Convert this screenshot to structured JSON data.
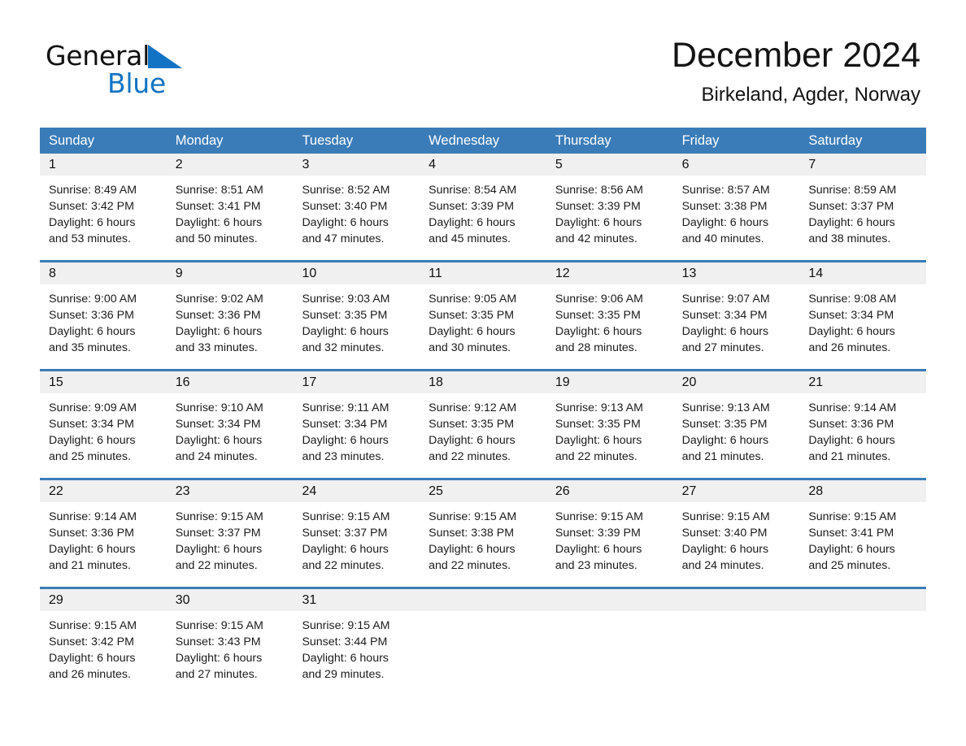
{
  "brand": {
    "name_part1": "General",
    "name_part2": "Blue",
    "triangle_color": "#1273c4",
    "text_color": "#101010"
  },
  "header": {
    "month_title": "December 2024",
    "location": "Birkeland, Agder, Norway"
  },
  "theme": {
    "header_blue": "#3a7cb8",
    "daynum_band": "#f0f0f0",
    "page_background": "#ffffff"
  },
  "weekdays": [
    "Sunday",
    "Monday",
    "Tuesday",
    "Wednesday",
    "Thursday",
    "Friday",
    "Saturday"
  ],
  "weeks": [
    {
      "days": [
        {
          "num": "1",
          "sunrise": "Sunrise: 8:49 AM",
          "sunset": "Sunset: 3:42 PM",
          "daylight_line1": "Daylight: 6 hours",
          "daylight_line2": "and 53 minutes."
        },
        {
          "num": "2",
          "sunrise": "Sunrise: 8:51 AM",
          "sunset": "Sunset: 3:41 PM",
          "daylight_line1": "Daylight: 6 hours",
          "daylight_line2": "and 50 minutes."
        },
        {
          "num": "3",
          "sunrise": "Sunrise: 8:52 AM",
          "sunset": "Sunset: 3:40 PM",
          "daylight_line1": "Daylight: 6 hours",
          "daylight_line2": "and 47 minutes."
        },
        {
          "num": "4",
          "sunrise": "Sunrise: 8:54 AM",
          "sunset": "Sunset: 3:39 PM",
          "daylight_line1": "Daylight: 6 hours",
          "daylight_line2": "and 45 minutes."
        },
        {
          "num": "5",
          "sunrise": "Sunrise: 8:56 AM",
          "sunset": "Sunset: 3:39 PM",
          "daylight_line1": "Daylight: 6 hours",
          "daylight_line2": "and 42 minutes."
        },
        {
          "num": "6",
          "sunrise": "Sunrise: 8:57 AM",
          "sunset": "Sunset: 3:38 PM",
          "daylight_line1": "Daylight: 6 hours",
          "daylight_line2": "and 40 minutes."
        },
        {
          "num": "7",
          "sunrise": "Sunrise: 8:59 AM",
          "sunset": "Sunset: 3:37 PM",
          "daylight_line1": "Daylight: 6 hours",
          "daylight_line2": "and 38 minutes."
        }
      ]
    },
    {
      "days": [
        {
          "num": "8",
          "sunrise": "Sunrise: 9:00 AM",
          "sunset": "Sunset: 3:36 PM",
          "daylight_line1": "Daylight: 6 hours",
          "daylight_line2": "and 35 minutes."
        },
        {
          "num": "9",
          "sunrise": "Sunrise: 9:02 AM",
          "sunset": "Sunset: 3:36 PM",
          "daylight_line1": "Daylight: 6 hours",
          "daylight_line2": "and 33 minutes."
        },
        {
          "num": "10",
          "sunrise": "Sunrise: 9:03 AM",
          "sunset": "Sunset: 3:35 PM",
          "daylight_line1": "Daylight: 6 hours",
          "daylight_line2": "and 32 minutes."
        },
        {
          "num": "11",
          "sunrise": "Sunrise: 9:05 AM",
          "sunset": "Sunset: 3:35 PM",
          "daylight_line1": "Daylight: 6 hours",
          "daylight_line2": "and 30 minutes."
        },
        {
          "num": "12",
          "sunrise": "Sunrise: 9:06 AM",
          "sunset": "Sunset: 3:35 PM",
          "daylight_line1": "Daylight: 6 hours",
          "daylight_line2": "and 28 minutes."
        },
        {
          "num": "13",
          "sunrise": "Sunrise: 9:07 AM",
          "sunset": "Sunset: 3:34 PM",
          "daylight_line1": "Daylight: 6 hours",
          "daylight_line2": "and 27 minutes."
        },
        {
          "num": "14",
          "sunrise": "Sunrise: 9:08 AM",
          "sunset": "Sunset: 3:34 PM",
          "daylight_line1": "Daylight: 6 hours",
          "daylight_line2": "and 26 minutes."
        }
      ]
    },
    {
      "days": [
        {
          "num": "15",
          "sunrise": "Sunrise: 9:09 AM",
          "sunset": "Sunset: 3:34 PM",
          "daylight_line1": "Daylight: 6 hours",
          "daylight_line2": "and 25 minutes."
        },
        {
          "num": "16",
          "sunrise": "Sunrise: 9:10 AM",
          "sunset": "Sunset: 3:34 PM",
          "daylight_line1": "Daylight: 6 hours",
          "daylight_line2": "and 24 minutes."
        },
        {
          "num": "17",
          "sunrise": "Sunrise: 9:11 AM",
          "sunset": "Sunset: 3:34 PM",
          "daylight_line1": "Daylight: 6 hours",
          "daylight_line2": "and 23 minutes."
        },
        {
          "num": "18",
          "sunrise": "Sunrise: 9:12 AM",
          "sunset": "Sunset: 3:35 PM",
          "daylight_line1": "Daylight: 6 hours",
          "daylight_line2": "and 22 minutes."
        },
        {
          "num": "19",
          "sunrise": "Sunrise: 9:13 AM",
          "sunset": "Sunset: 3:35 PM",
          "daylight_line1": "Daylight: 6 hours",
          "daylight_line2": "and 22 minutes."
        },
        {
          "num": "20",
          "sunrise": "Sunrise: 9:13 AM",
          "sunset": "Sunset: 3:35 PM",
          "daylight_line1": "Daylight: 6 hours",
          "daylight_line2": "and 21 minutes."
        },
        {
          "num": "21",
          "sunrise": "Sunrise: 9:14 AM",
          "sunset": "Sunset: 3:36 PM",
          "daylight_line1": "Daylight: 6 hours",
          "daylight_line2": "and 21 minutes."
        }
      ]
    },
    {
      "days": [
        {
          "num": "22",
          "sunrise": "Sunrise: 9:14 AM",
          "sunset": "Sunset: 3:36 PM",
          "daylight_line1": "Daylight: 6 hours",
          "daylight_line2": "and 21 minutes."
        },
        {
          "num": "23",
          "sunrise": "Sunrise: 9:15 AM",
          "sunset": "Sunset: 3:37 PM",
          "daylight_line1": "Daylight: 6 hours",
          "daylight_line2": "and 22 minutes."
        },
        {
          "num": "24",
          "sunrise": "Sunrise: 9:15 AM",
          "sunset": "Sunset: 3:37 PM",
          "daylight_line1": "Daylight: 6 hours",
          "daylight_line2": "and 22 minutes."
        },
        {
          "num": "25",
          "sunrise": "Sunrise: 9:15 AM",
          "sunset": "Sunset: 3:38 PM",
          "daylight_line1": "Daylight: 6 hours",
          "daylight_line2": "and 22 minutes."
        },
        {
          "num": "26",
          "sunrise": "Sunrise: 9:15 AM",
          "sunset": "Sunset: 3:39 PM",
          "daylight_line1": "Daylight: 6 hours",
          "daylight_line2": "and 23 minutes."
        },
        {
          "num": "27",
          "sunrise": "Sunrise: 9:15 AM",
          "sunset": "Sunset: 3:40 PM",
          "daylight_line1": "Daylight: 6 hours",
          "daylight_line2": "and 24 minutes."
        },
        {
          "num": "28",
          "sunrise": "Sunrise: 9:15 AM",
          "sunset": "Sunset: 3:41 PM",
          "daylight_line1": "Daylight: 6 hours",
          "daylight_line2": "and 25 minutes."
        }
      ]
    },
    {
      "days": [
        {
          "num": "29",
          "sunrise": "Sunrise: 9:15 AM",
          "sunset": "Sunset: 3:42 PM",
          "daylight_line1": "Daylight: 6 hours",
          "daylight_line2": "and 26 minutes."
        },
        {
          "num": "30",
          "sunrise": "Sunrise: 9:15 AM",
          "sunset": "Sunset: 3:43 PM",
          "daylight_line1": "Daylight: 6 hours",
          "daylight_line2": "and 27 minutes."
        },
        {
          "num": "31",
          "sunrise": "Sunrise: 9:15 AM",
          "sunset": "Sunset: 3:44 PM",
          "daylight_line1": "Daylight: 6 hours",
          "daylight_line2": "and 29 minutes."
        },
        {
          "num": "",
          "sunrise": "",
          "sunset": "",
          "daylight_line1": "",
          "daylight_line2": ""
        },
        {
          "num": "",
          "sunrise": "",
          "sunset": "",
          "daylight_line1": "",
          "daylight_line2": ""
        },
        {
          "num": "",
          "sunrise": "",
          "sunset": "",
          "daylight_line1": "",
          "daylight_line2": ""
        },
        {
          "num": "",
          "sunrise": "",
          "sunset": "",
          "daylight_line1": "",
          "daylight_line2": ""
        }
      ]
    }
  ]
}
